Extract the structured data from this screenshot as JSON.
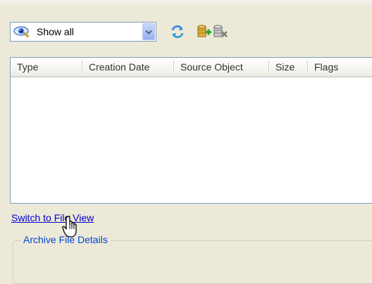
{
  "toolbar": {
    "filter_combo": {
      "selected": "Show all",
      "icon": "eye-icon"
    },
    "buttons": [
      {
        "name": "refresh-button",
        "icon": "refresh-icon"
      },
      {
        "name": "add-archive-button",
        "icon": "database-add-icon"
      },
      {
        "name": "remove-archive-button",
        "icon": "database-remove-icon"
      }
    ]
  },
  "list": {
    "columns": [
      "Type",
      "Creation Date",
      "Source Object",
      "Size",
      "Flags"
    ],
    "rows": []
  },
  "link": {
    "switch_view": "Switch to File View"
  },
  "groupbox": {
    "title": "Archive File Details"
  },
  "colors": {
    "background": "#ece9d8",
    "border": "#7f9db9",
    "link": "#0000cc",
    "group_title": "#0046d5"
  }
}
